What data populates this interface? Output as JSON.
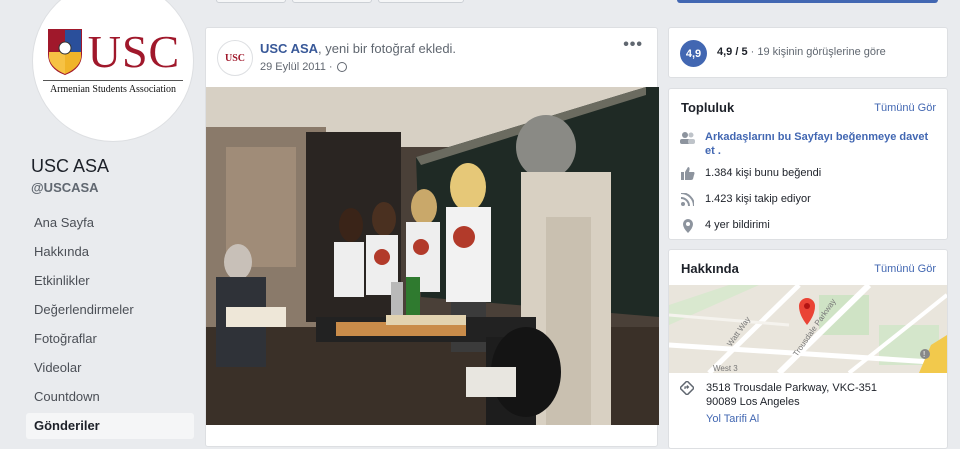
{
  "sidebar": {
    "logo_text": "USC",
    "logo_subtitle": "Armenian Students Association",
    "page_name": "USC ASA",
    "page_handle": "@USCASA",
    "nav": [
      {
        "label": "Ana Sayfa"
      },
      {
        "label": "Hakkında"
      },
      {
        "label": "Etkinlikler"
      },
      {
        "label": "Değerlendirmeler"
      },
      {
        "label": "Fotoğraflar"
      },
      {
        "label": "Videolar"
      },
      {
        "label": "Countdown"
      },
      {
        "label": "Gönderiler"
      }
    ]
  },
  "post": {
    "avatar_text": "USC",
    "author": "USC ASA",
    "action": ", yeni bir fotoğraf ekledi.",
    "date": "29 Eylül 2011 ·",
    "more": "•••"
  },
  "rating": {
    "badge": "4,9",
    "score": "4,9 / 5",
    "detail": " · 19 kişinin görüşlerine göre"
  },
  "community": {
    "title": "Topluluk",
    "see_all": "Tümünü Gör",
    "invite": "Arkadaşlarını bu Sayfayı beğenmeye davet et .",
    "likes": "1.384 kişi bunu beğendi",
    "follows": "1.423 kişi takip ediyor",
    "checkins": "4 yer bildirimi"
  },
  "about": {
    "title": "Hakkında",
    "see_all": "Tümünü Gör",
    "map_labels": [
      "Watt Way",
      "Trousdale Parkway",
      "West 3"
    ],
    "address_line1": "3518 Trousdale Parkway, VKC-351",
    "address_line2": "90089 Los Angeles",
    "directions": "Yol Tarifi Al"
  },
  "colors": {
    "brand_blue": "#4267b2",
    "link_blue": "#385898",
    "usc_red": "#a0182b",
    "bg": "#e9ebee"
  }
}
